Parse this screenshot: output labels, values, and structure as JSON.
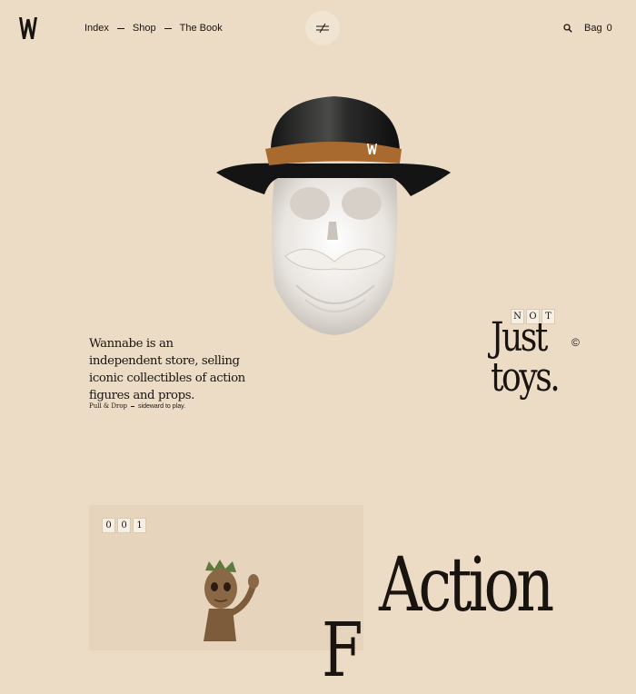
{
  "brand": {
    "logo_letter": "W"
  },
  "nav": {
    "items": [
      "Index",
      "Shop",
      "The Book"
    ]
  },
  "menu_button": {
    "icon": "menu-toggle-icon"
  },
  "header": {
    "search_icon": "search-icon",
    "bag_label": "Bag",
    "bag_count": "0"
  },
  "hero": {
    "image": "skull-with-hat",
    "intro_text": "Wannabe is an independent store, selling iconic collectibles of action figures and props.",
    "hint_bold": "Pull & Drop",
    "hint_text": "sideward to play."
  },
  "tagline": {
    "not_letters": [
      "N",
      "O",
      "T"
    ],
    "line1": "Just",
    "line2": "toys.",
    "copyright": "©"
  },
  "feature": {
    "index_digits": [
      "0",
      "0",
      "1"
    ],
    "image": "groot-action-figure",
    "title_line1": "Action",
    "title_line2": "F"
  }
}
